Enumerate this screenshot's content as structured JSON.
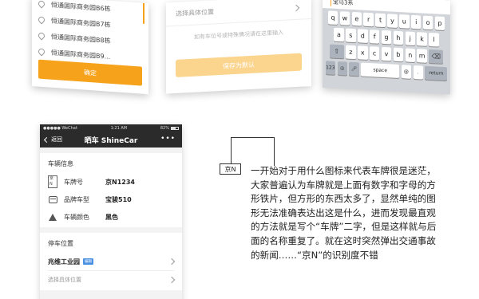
{
  "address_picker": {
    "items": [
      "恒通国际商务园B6栋",
      "恒通国际商务园B7栋",
      "恒通国际商务园B8栋",
      "恒通国际商务园B9..."
    ],
    "confirm_label": "确定",
    "accent_color": "#f7a21b"
  },
  "position_form": {
    "select_label": "选择具体位置",
    "hint": "如有车位号或特殊情况请在这里输入",
    "save_label": "保存为默认",
    "save_color": "#fbd48e"
  },
  "keyboard": {
    "input_value": "宝马3系",
    "row1": [
      "q",
      "w",
      "e",
      "r",
      "t",
      "y",
      "u",
      "i",
      "o",
      "p"
    ],
    "row2": [
      "a",
      "s",
      "d",
      "f",
      "g",
      "h",
      "j",
      "k",
      "l"
    ],
    "row3": [
      "z",
      "x",
      "c",
      "v",
      "b",
      "n",
      "m"
    ],
    "space_label": "space",
    "return_label": "return",
    "numbers_label": "123"
  },
  "phone": {
    "status_carrier": "●●●●● WeChat",
    "status_time": "1:21 AM",
    "status_battery": "82%",
    "back_label": "返回",
    "title": "晒车 ShineCar",
    "more": "•••",
    "vehicle_section_title": "车辆信息",
    "plate_icon_text": "京N",
    "rows": [
      {
        "label": "车牌号",
        "value": "京N1234"
      },
      {
        "label": "品牌车型",
        "value": "宝骏510"
      },
      {
        "label": "车辆颜色",
        "value": "黑色"
      }
    ],
    "parking_section_title": "停车位置",
    "parking_name": "兆维工业园",
    "parking_badge": "编辑",
    "select_label": "选择具体位置"
  },
  "annotation": {
    "plate_label": "京N",
    "description": "一开始对于用什么图标来代表车牌很是迷茫，大家普遍认为车牌就是上面有数字和字母的方形铁片，但方形的东西太多了，显然单纯的图形无法准确表达出这是什么，进而发现最直观的方法就是写个“车牌”二字，但是这样就与后面的名称重复了。就在这时突然弹出交通事故的新闻……“京N”的识别度不错"
  }
}
